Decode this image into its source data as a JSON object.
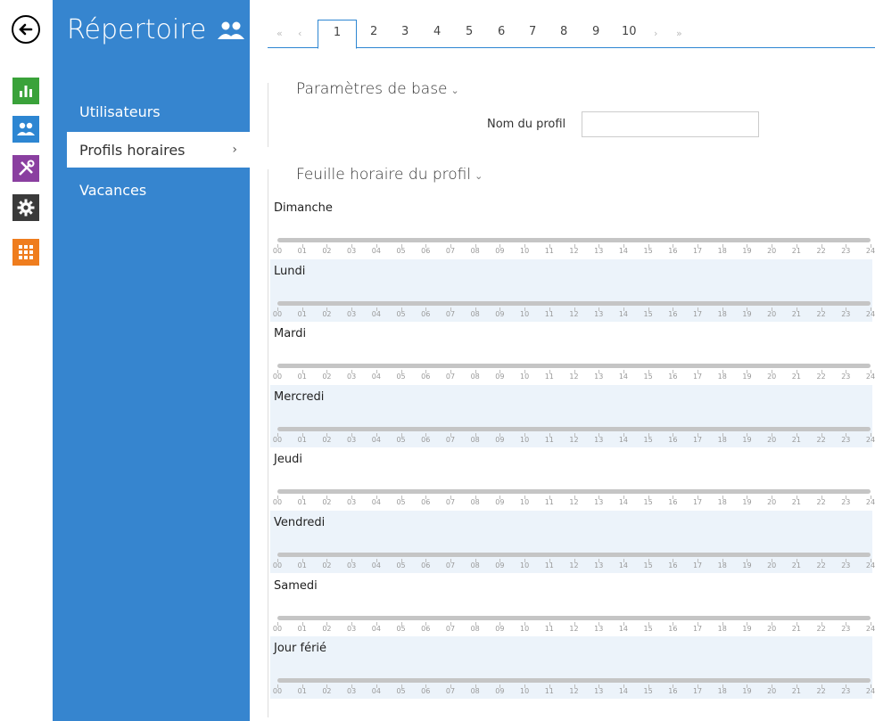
{
  "rail": {
    "icons": [
      {
        "name": "status-icon",
        "color": "#3aa23a"
      },
      {
        "name": "directory-icon",
        "color": "#2d86d2"
      },
      {
        "name": "hardware-icon",
        "color": "#8a3fa0"
      },
      {
        "name": "system-icon",
        "color": "#3a3a3a"
      },
      {
        "name": "services-icon",
        "color": "#ef7d1e"
      }
    ]
  },
  "nav": {
    "title": "Répertoire",
    "items": [
      {
        "label": "Utilisateurs"
      },
      {
        "label": "Profils horaires",
        "active": true
      },
      {
        "label": "Vacances"
      }
    ]
  },
  "tabs": {
    "first": "«",
    "prev": "‹",
    "pages": [
      "1",
      "2",
      "3",
      "4",
      "5",
      "6",
      "7",
      "8",
      "9",
      "10"
    ],
    "active_page": "1",
    "next": "›",
    "last": "»"
  },
  "basic": {
    "title": "Paramètres de base",
    "profile_name_label": "Nom du profil",
    "profile_name_value": ""
  },
  "schedule": {
    "title": "Feuille horaire du profil",
    "days": [
      "Dimanche",
      "Lundi",
      "Mardi",
      "Mercredi",
      "Jeudi",
      "Vendredi",
      "Samedi",
      "Jour férié"
    ],
    "hours": [
      "00",
      "01",
      "02",
      "03",
      "04",
      "05",
      "06",
      "07",
      "08",
      "09",
      "10",
      "11",
      "12",
      "13",
      "14",
      "15",
      "16",
      "17",
      "18",
      "19",
      "20",
      "21",
      "22",
      "23",
      "24"
    ]
  }
}
